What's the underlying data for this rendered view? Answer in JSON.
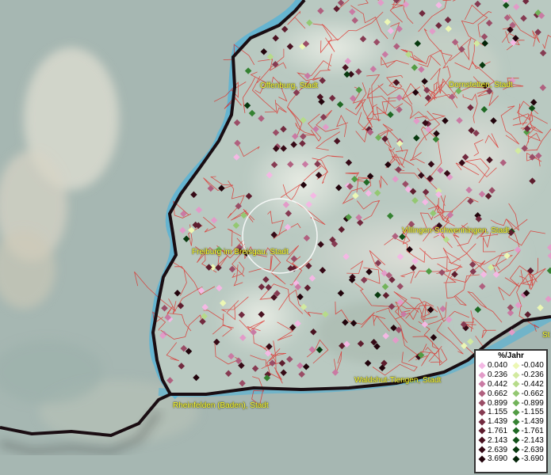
{
  "legend": {
    "title": "%/Jahr",
    "positive": [
      {
        "label": "0.040",
        "color": "#f4b8e4"
      },
      {
        "label": "0.236",
        "color": "#e29bc8"
      },
      {
        "label": "0.442",
        "color": "#c97aa3"
      },
      {
        "label": "0.662",
        "color": "#b0607f"
      },
      {
        "label": "0.899",
        "color": "#9a4d66"
      },
      {
        "label": "1.155",
        "color": "#863b52"
      },
      {
        "label": "1.439",
        "color": "#722a3f"
      },
      {
        "label": "1.761",
        "color": "#5e1d2e"
      },
      {
        "label": "2.143",
        "color": "#4a1221"
      },
      {
        "label": "2.639",
        "color": "#360a16"
      },
      {
        "label": "3.690",
        "color": "#22040c"
      }
    ],
    "negative": [
      {
        "label": "-0.040",
        "color": "#ecf7b4"
      },
      {
        "label": "-0.236",
        "color": "#d2eaa0"
      },
      {
        "label": "-0.442",
        "color": "#b6db8a"
      },
      {
        "label": "-0.662",
        "color": "#94c872"
      },
      {
        "label": "-0.899",
        "color": "#72b35a"
      },
      {
        "label": "-1.155",
        "color": "#529c44"
      },
      {
        "label": "-1.439",
        "color": "#358232"
      },
      {
        "label": "-1.761",
        "color": "#1f6924"
      },
      {
        "label": "-2.143",
        "color": "#115018"
      },
      {
        "label": "-2.639",
        "color": "#08390f"
      },
      {
        "label": "-3.690",
        "color": "#032307"
      }
    ]
  },
  "cities": [
    {
      "name": "Offenburg, Stadt"
    },
    {
      "name": "Dornstetten, Stadt"
    },
    {
      "name": "Villingen-Schwenningen, Stadt"
    },
    {
      "name": "Freiburg im Breisgau, Stadt"
    },
    {
      "name": "Waldshut-Tiengen, Stadt"
    },
    {
      "name": "Rheinfelden (Baden), Stadt"
    },
    {
      "name": "St"
    }
  ]
}
